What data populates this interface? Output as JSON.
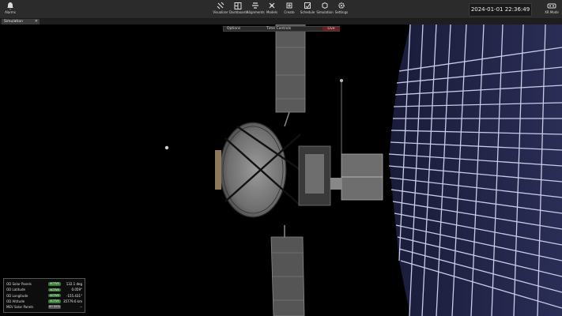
{
  "toolbar": {
    "alarms": "Alarms",
    "items": [
      "Visualizer",
      "Dashboards",
      "Alignments",
      "Models",
      "Create",
      "Schedule",
      "Simulation",
      "Settings"
    ],
    "xr_mode": "XR Mode",
    "clock": "2024-01-01 22:36:49 UTC"
  },
  "tabs": {
    "simulation": "Simulation",
    "close": "✕"
  },
  "controls": {
    "options": "Options",
    "time": "Time Controls",
    "live": "Live"
  },
  "telemetry": [
    {
      "name": "OD Solar Panels",
      "status": "ACTIVE",
      "value": "132.1 deg"
    },
    {
      "name": "OD Latitude",
      "status": "ACTIVE",
      "value": "0.059°"
    },
    {
      "name": "OD Longitude",
      "status": "ACTIVE",
      "value": "-155.431°"
    },
    {
      "name": "OD Altitude",
      "status": "ACTIVE",
      "value": "35779.6 km"
    },
    {
      "name": "MEV Solar Panels",
      "status": "NO DATA",
      "value": "--"
    }
  ],
  "colors": {
    "active": "#3a7a3a",
    "live": "#6b2020",
    "panel_grid": "#c9cbe6"
  }
}
